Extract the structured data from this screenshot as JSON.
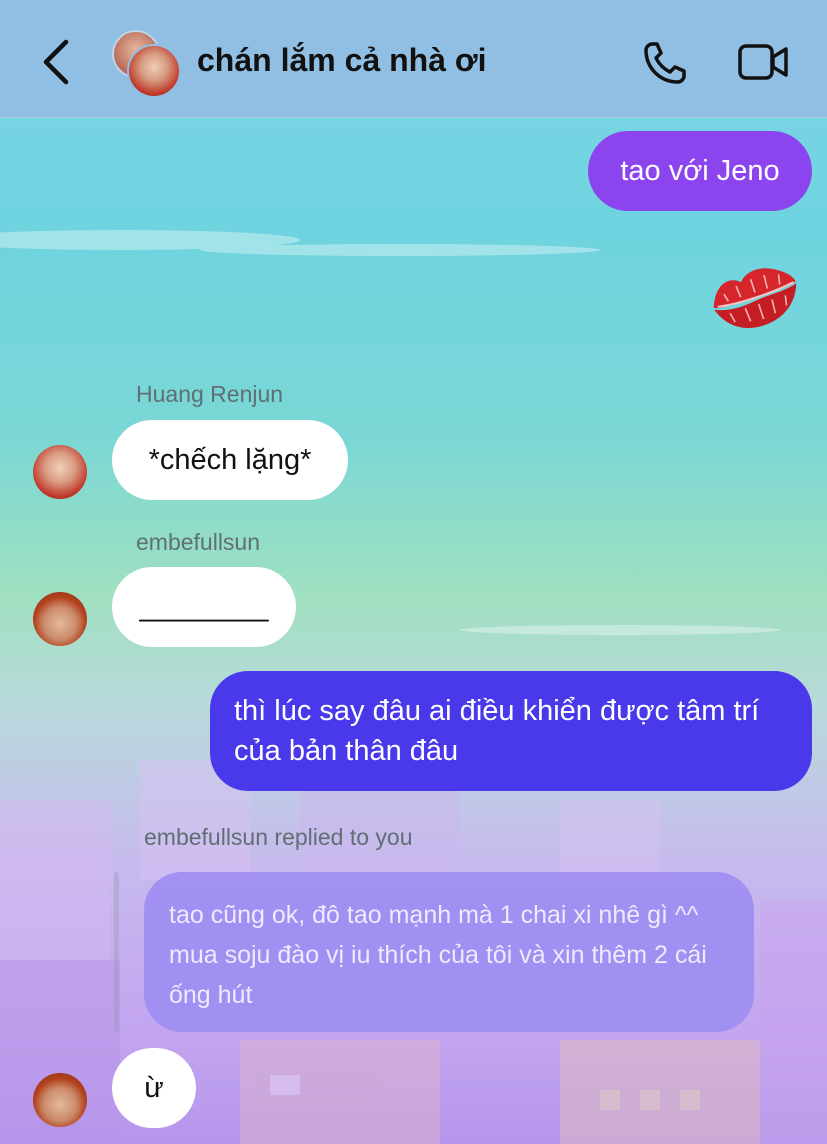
{
  "header": {
    "title": "chán lắm cả nhà ơi"
  },
  "messages": {
    "out1": "tao với Jeno",
    "reaction_emoji": "💋",
    "sender1": "Huang Renjun",
    "in1": "*chếch lặng*",
    "sender2": "embefullsun",
    "in2": "________",
    "out2": "thì lúc say đâu ai điều khiển được tâm trí của bản thân đâu",
    "reply_label": "embefullsun replied to you",
    "quoted": "tao cũng ok, đô tao mạnh mà 1 chai xi nhê gì ^^ mua soju đào vị iu thích của tôi và xin thêm 2 cái ống hút",
    "in3": "ừ"
  },
  "icons": {
    "back": "chevron-left-icon",
    "call": "phone-icon",
    "video": "video-camera-icon"
  },
  "colors": {
    "header_bg": "#90bfe3",
    "outgoing_purple": "#8c44ef",
    "outgoing_blue": "#4a39ea",
    "incoming_bg": "#ffffff",
    "quoted_bg": "#a08df1"
  }
}
